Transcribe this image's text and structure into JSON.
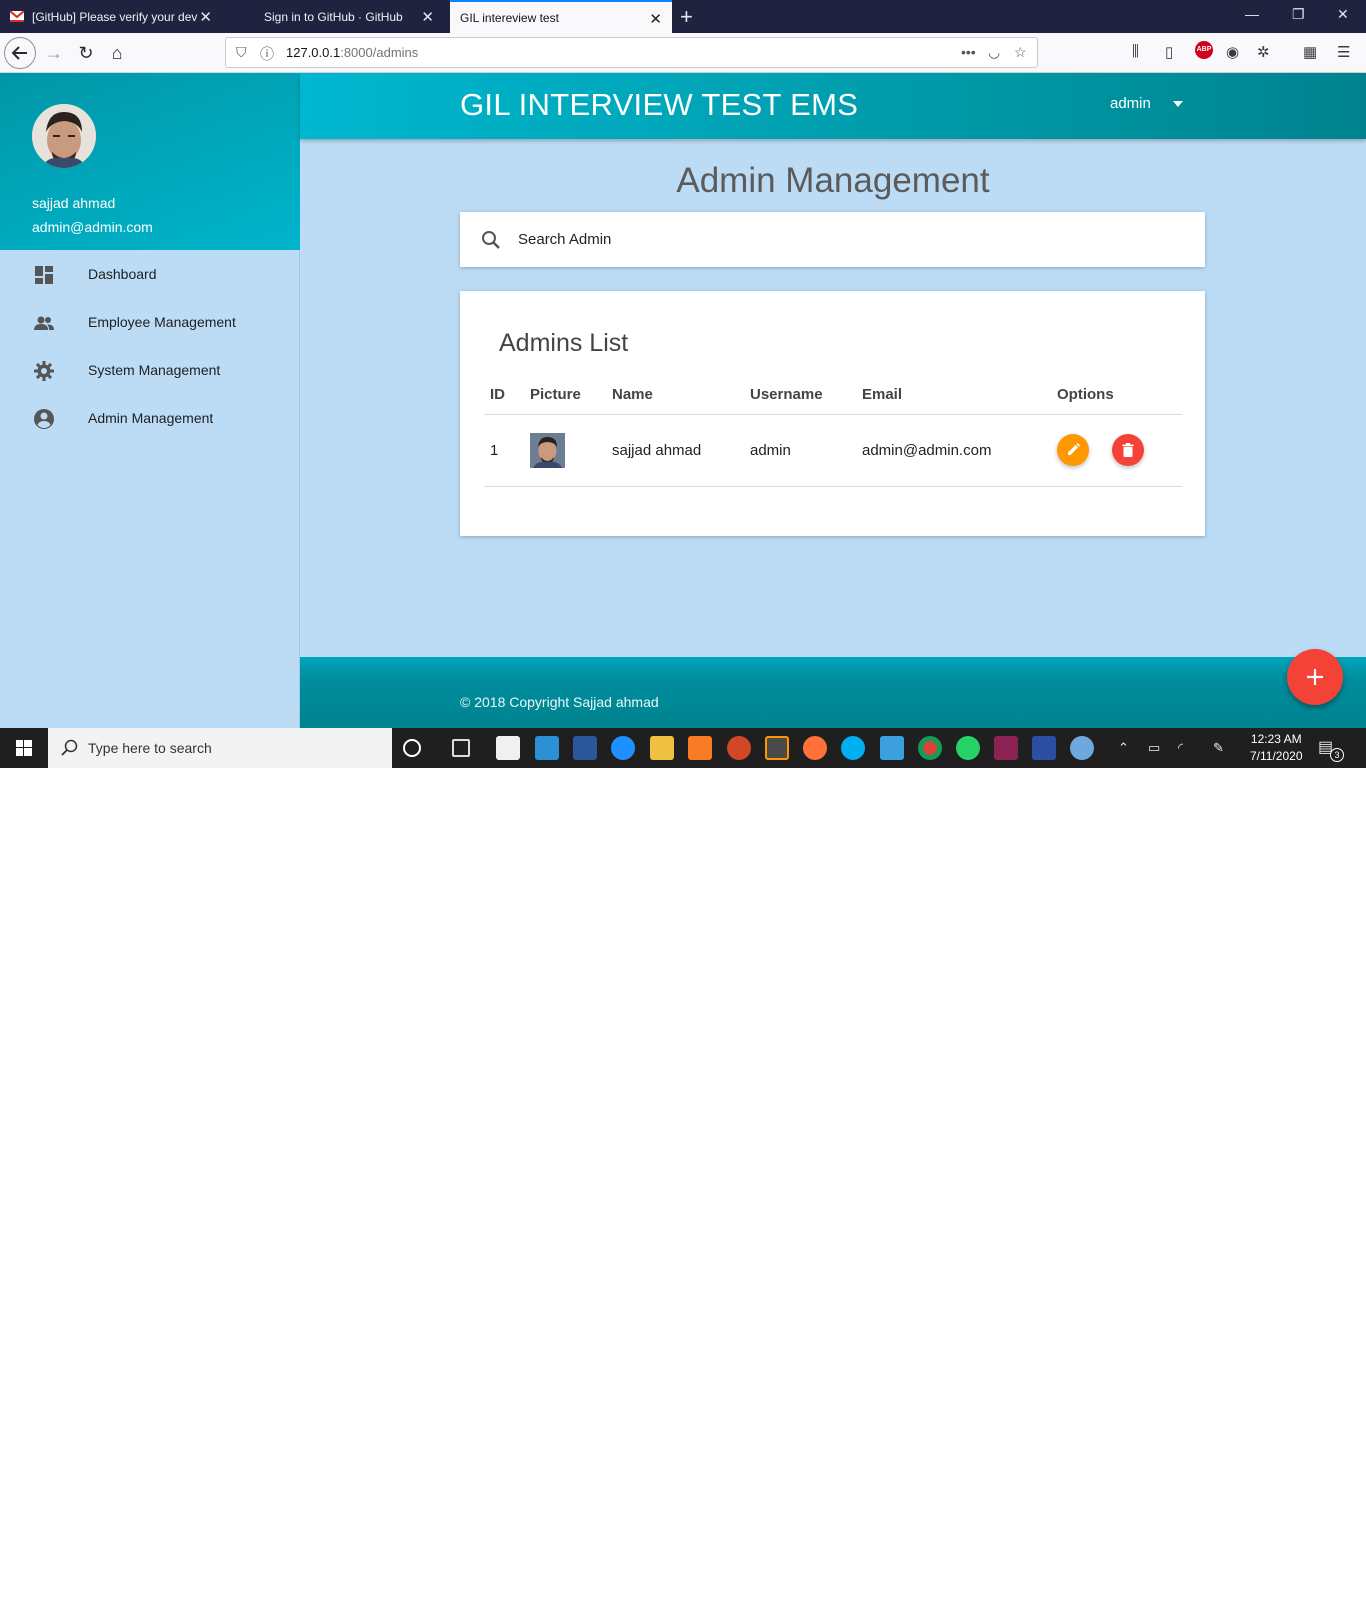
{
  "browser": {
    "tabs": [
      {
        "label": "[GitHub] Please verify your dev"
      },
      {
        "label": "Sign in to GitHub · GitHub"
      },
      {
        "label": "GIL intereview test"
      }
    ],
    "url_host": "127.0.0.1",
    "url_path": ":8000/admins"
  },
  "app": {
    "title": "GIL INTERVIEW TEST EMS",
    "user_menu": "admin"
  },
  "sidebar": {
    "user_name": "sajjad ahmad",
    "user_email": "admin@admin.com",
    "items": [
      {
        "label": "Dashboard",
        "icon": "dashboard-icon"
      },
      {
        "label": "Employee Management",
        "icon": "people-icon"
      },
      {
        "label": "System Management",
        "icon": "gear-icon"
      },
      {
        "label": "Admin Management",
        "icon": "account-circle-icon"
      }
    ]
  },
  "main": {
    "page_title": "Admin Management",
    "search_placeholder": "Search Admin",
    "list_title": "Admins List",
    "columns": [
      "ID",
      "Picture",
      "Name",
      "Username",
      "Email",
      "Options"
    ],
    "rows": [
      {
        "id": "1",
        "name": "sajjad ahmad",
        "username": "admin",
        "email": "admin@admin.com"
      }
    ]
  },
  "footer": {
    "text": "© 2018 Copyright Sajjad ahmad"
  },
  "taskbar": {
    "search_placeholder": "Type here to search",
    "time": "12:23 AM",
    "date": "7/11/2020",
    "notification_count": "3"
  },
  "colors": {
    "accent": "#00acc1",
    "edit": "#ff9800",
    "delete": "#f44336"
  }
}
